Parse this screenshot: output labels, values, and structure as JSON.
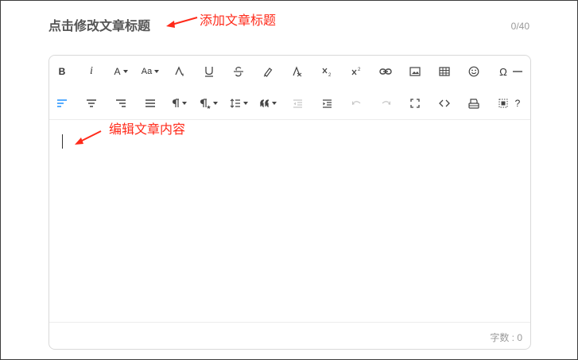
{
  "title": {
    "placeholder": "点击修改文章标题",
    "counter": "0/40"
  },
  "annotations": {
    "title_hint": "添加文章标题",
    "content_hint": "编辑文章内容",
    "color": "#ff2a1a"
  },
  "toolbar": {
    "row1": [
      {
        "name": "bold-button",
        "label": "B",
        "icon": "bold-icon"
      },
      {
        "name": "italic-button",
        "label": "i",
        "icon": "italic-icon"
      },
      {
        "name": "font-color-dropdown",
        "label": "A",
        "icon": "font-color-icon"
      },
      {
        "name": "font-size-dropdown",
        "label": "Aa",
        "icon": "font-size-icon"
      },
      {
        "name": "background-color-button",
        "icon": "fill-drip-icon"
      },
      {
        "name": "underline-button",
        "icon": "underline-icon"
      },
      {
        "name": "strikethrough-button",
        "icon": "strikethrough-icon"
      },
      {
        "name": "highlighter-button",
        "icon": "highlighter-icon"
      },
      {
        "name": "clear-format-button",
        "icon": "clear-format-icon"
      },
      {
        "name": "subscript-button",
        "icon": "subscript-icon"
      },
      {
        "name": "superscript-button",
        "icon": "superscript-icon"
      },
      {
        "name": "insert-link-button",
        "icon": "link-icon"
      },
      {
        "name": "insert-image-button",
        "icon": "image-icon"
      },
      {
        "name": "insert-table-button",
        "icon": "table-icon"
      },
      {
        "name": "insert-emoji-button",
        "icon": "smiley-icon"
      },
      {
        "name": "special-character-button",
        "label": "Ω",
        "icon": "omega-icon"
      },
      {
        "name": "horizontal-rule-button",
        "icon": "horizontal-rule-icon"
      }
    ],
    "row2": [
      {
        "name": "align-left-button",
        "icon": "align-left-icon",
        "state": "active"
      },
      {
        "name": "align-center-button",
        "icon": "align-center-icon"
      },
      {
        "name": "align-right-button",
        "icon": "align-right-icon"
      },
      {
        "name": "justify-button",
        "icon": "align-justify-icon"
      },
      {
        "name": "paragraph-dropdown",
        "icon": "pilcrow-icon"
      },
      {
        "name": "paragraph-style-dropdown",
        "icon": "pilcrow-star-icon"
      },
      {
        "name": "line-height-dropdown",
        "icon": "line-height-icon"
      },
      {
        "name": "quote-dropdown",
        "icon": "quote-icon"
      },
      {
        "name": "outdent-button",
        "icon": "outdent-icon",
        "state": "disabled"
      },
      {
        "name": "indent-button",
        "icon": "indent-icon"
      },
      {
        "name": "undo-button",
        "icon": "undo-icon",
        "state": "disabled"
      },
      {
        "name": "redo-button",
        "icon": "redo-icon",
        "state": "disabled"
      },
      {
        "name": "fullscreen-button",
        "icon": "fullscreen-icon"
      },
      {
        "name": "source-code-button",
        "icon": "code-icon"
      },
      {
        "name": "print-button",
        "icon": "print-icon"
      },
      {
        "name": "select-all-button",
        "icon": "select-all-icon"
      },
      {
        "name": "help-button",
        "label": "?",
        "icon": "help-icon"
      }
    ]
  },
  "footer": {
    "word_count": "字数 : 0"
  },
  "colors": {
    "active": "#1e90ff",
    "border": "#d9d9d9",
    "icon": "#444444",
    "disabled": "#c6c6c6"
  }
}
